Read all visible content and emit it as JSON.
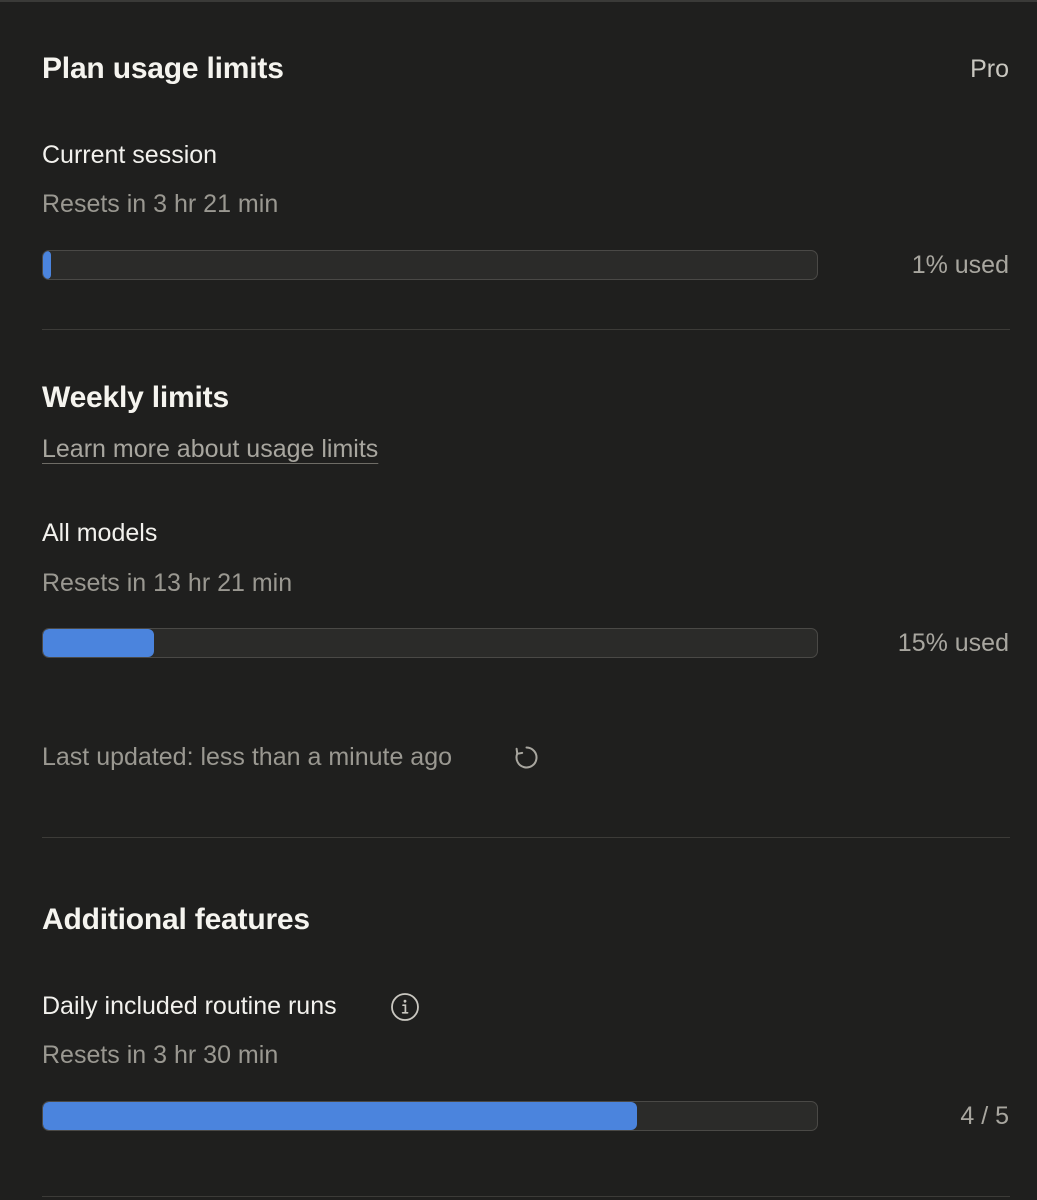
{
  "plan": {
    "title": "Plan usage limits",
    "tier": "Pro"
  },
  "current_session": {
    "label": "Current session",
    "resets": "Resets in 3 hr 21 min",
    "used_text": "1% used",
    "used_fraction": 0.01
  },
  "weekly": {
    "title": "Weekly limits",
    "learn_more": "Learn more about usage limits",
    "all_models": {
      "label": "All models",
      "resets": "Resets in 13 hr 21 min",
      "used_text": "15% used",
      "used_fraction": 0.15
    },
    "last_updated": "Last updated: less than a minute ago"
  },
  "additional": {
    "title": "Additional features",
    "routine_runs": {
      "label": "Daily included routine runs",
      "resets": "Resets in 3 hr 30 min",
      "used_text": "4 / 5",
      "used_fraction": 0.8
    }
  },
  "colors": {
    "background": "#1f1f1e",
    "accent": "#4b84dd",
    "track": "#2b2b29"
  },
  "icons": {
    "refresh": "refresh-icon",
    "info": "info-icon"
  }
}
